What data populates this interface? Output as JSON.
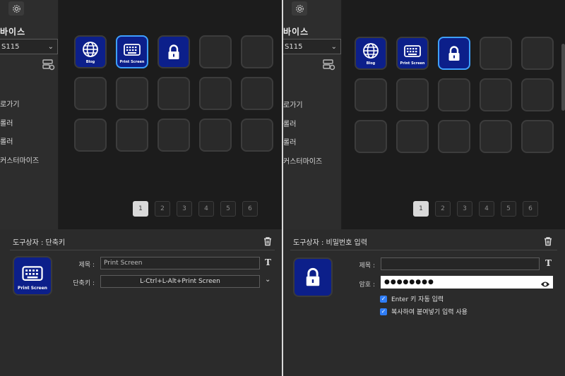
{
  "left": {
    "sidebar": {
      "device_title": "바이스",
      "device_select_value": "S115",
      "menu": [
        "로가기",
        "롤러",
        "롤러",
        "커스터마이즈"
      ]
    },
    "grid": {
      "keys": [
        {
          "icon": "globe-icon",
          "label": "Blog",
          "filled": true,
          "selected": false
        },
        {
          "icon": "keyboard-icon",
          "label": "Print Screen",
          "filled": true,
          "selected": true
        },
        {
          "icon": "lock-icon",
          "label": "",
          "filled": true,
          "selected": false
        },
        {
          "filled": false
        },
        {
          "filled": false
        },
        {
          "filled": false
        },
        {
          "filled": false
        },
        {
          "filled": false
        },
        {
          "filled": false
        },
        {
          "filled": false
        },
        {
          "filled": false
        },
        {
          "filled": false
        },
        {
          "filled": false
        },
        {
          "filled": false
        },
        {
          "filled": false
        }
      ]
    },
    "pager": [
      "1",
      "2",
      "3",
      "4",
      "5",
      "6"
    ],
    "bottom": {
      "title": "도구상자 : 단축키",
      "preview_label": "Print Screen",
      "title_field_label": "제목 :",
      "title_field_value": "Print Screen",
      "shortcut_label": "단축키 :",
      "shortcut_value": "L-Ctrl+L-Alt+Print Screen"
    }
  },
  "right": {
    "sidebar": {
      "device_title": "바이스",
      "device_select_value": "S115",
      "menu": [
        "로가기",
        "롤러",
        "롤러",
        "커스터마이즈"
      ]
    },
    "grid": {
      "keys": [
        {
          "icon": "globe-icon",
          "label": "Blog",
          "filled": true,
          "selected": false
        },
        {
          "icon": "keyboard-icon",
          "label": "Print Screen",
          "filled": true,
          "selected": false
        },
        {
          "icon": "lock-icon",
          "label": "",
          "filled": true,
          "selected": true
        },
        {
          "filled": false
        },
        {
          "filled": false
        },
        {
          "filled": false
        },
        {
          "filled": false
        },
        {
          "filled": false
        },
        {
          "filled": false
        },
        {
          "filled": false
        },
        {
          "filled": false
        },
        {
          "filled": false
        },
        {
          "filled": false
        },
        {
          "filled": false
        },
        {
          "filled": false
        }
      ]
    },
    "pager": [
      "1",
      "2",
      "3",
      "4",
      "5",
      "6"
    ],
    "bottom": {
      "title": "도구상자 : 비밀번호 입력",
      "title_field_label": "제목 :",
      "title_field_value": "",
      "password_label": "암호 :",
      "password_value": "●●●●●●●●",
      "option_enter": "Enter 키 자동 입력",
      "option_paste": "복사하여 붙여넣기 입력 사용"
    }
  },
  "colors": {
    "key_fill": "#0c1f8a",
    "selected_border": "#3ea0ff",
    "checkbox": "#2f7df6"
  }
}
